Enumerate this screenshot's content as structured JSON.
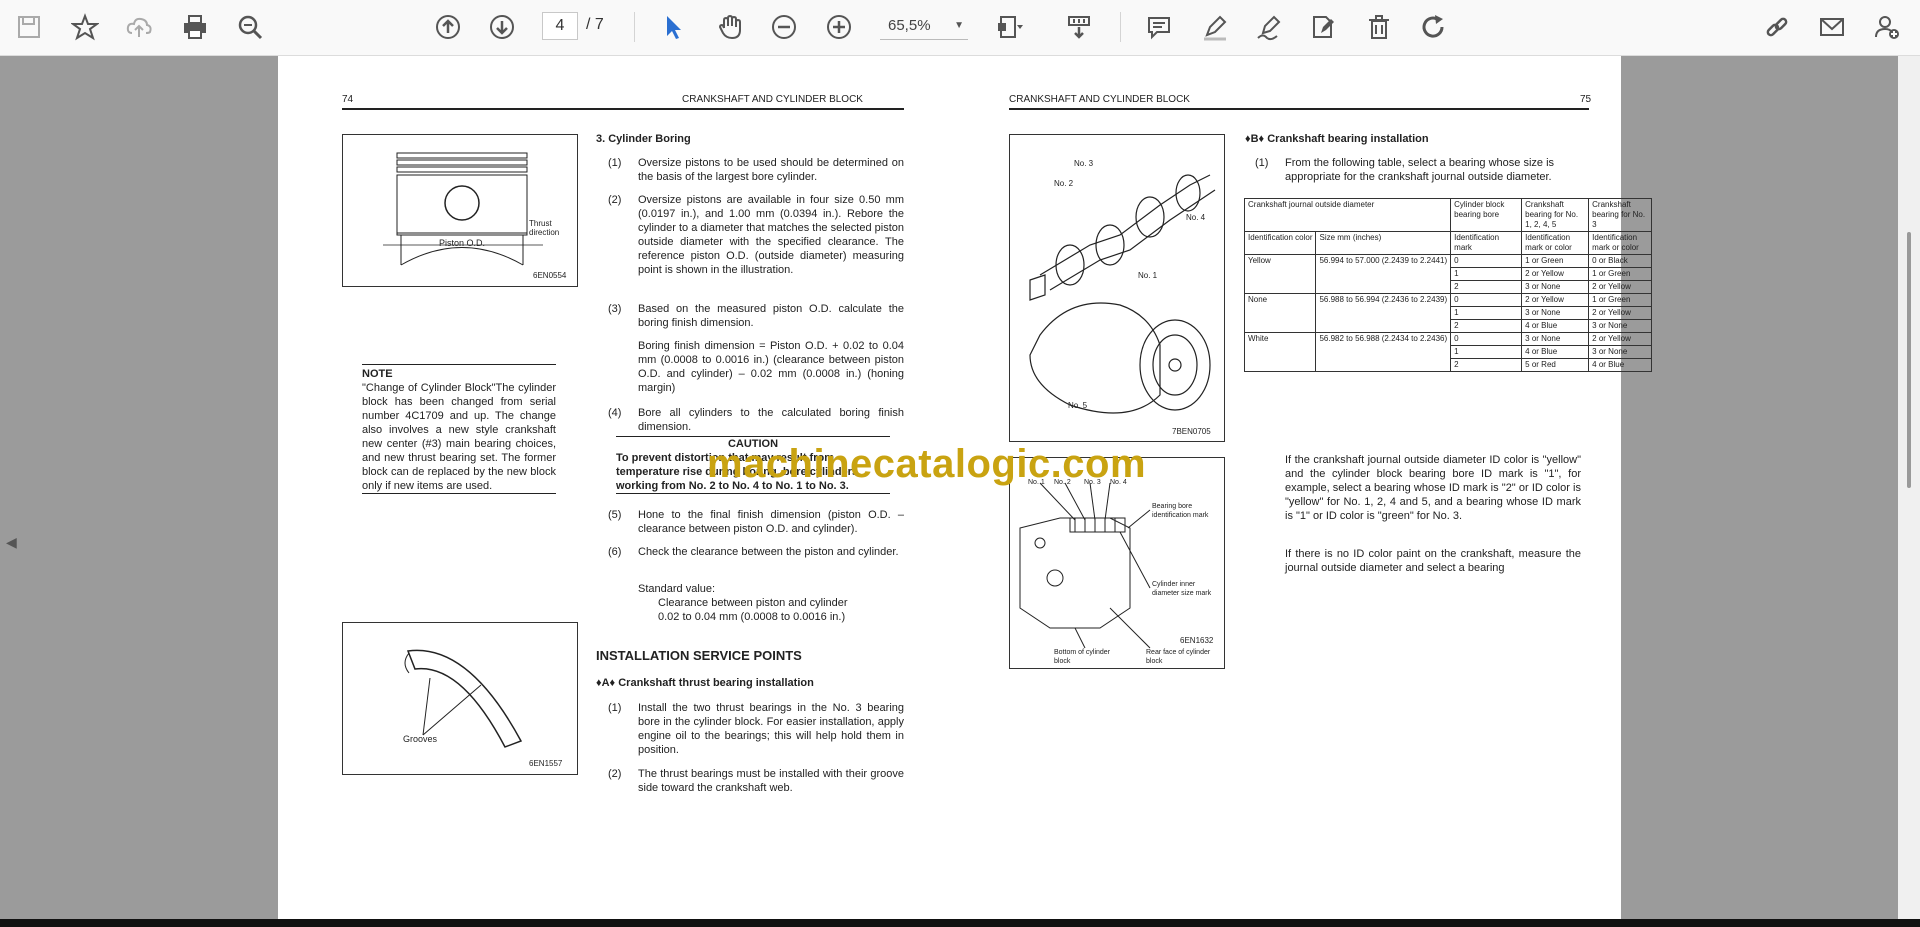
{
  "toolbar": {
    "page_current": "4",
    "page_total": "/ 7",
    "zoom": "65,5%"
  },
  "watermark": "machinecatalogic.com",
  "left_page": {
    "page_number": "74",
    "running_header": "CRANKSHAFT AND CYLINDER BLOCK",
    "fig1_caption": "6EN0554",
    "fig1_thrust": "Thrust direction",
    "fig1_piston": "Piston O.D.",
    "fig2_caption": "6EN1557",
    "fig2_label": "Grooves",
    "note_title": "NOTE",
    "note_body": "\"Change of Cylinder Block\"The cylinder block has been changed from serial number 4C1709 and up. The change also involves a new style crankshaft new center (#3) main bearing choices, and new thrust bearing set. The former block can de replaced by the new block only if new items are used.",
    "section3_title": "3.  Cylinder Boring",
    "step1": "Oversize pistons to be used should be determined on the basis of the largest bore cylinder.",
    "step2": "Oversize pistons are available in four size 0.50 mm (0.0197 in.), and 1.00 mm (0.0394 in.). Rebore the cylinder to a diameter that matches the selected piston outside diameter with the specified clearance. The reference piston O.D. (outside diameter) measuring point is shown in the illustration.",
    "step3": "Based on the measured piston O.D. calculate the boring finish dimension.",
    "boring_formula": "Boring finish dimension = Piston O.D. + 0.02 to 0.04 mm (0.0008 to 0.0016 in.) (clearance between piston O.D. and cylinder) – 0.02 mm (0.0008 in.) (honing margin)",
    "step4": "Bore all cylinders to the calculated boring finish dimension.",
    "caution_title": "CAUTION",
    "caution_body": "To prevent distortion that may result from temperature rise during boring, bore cylinders, working from No. 2 to No. 4 to No. 1 to No. 3.",
    "step5": "Hone to the final finish dimension (piston O.D. – clearance between piston O.D. and cylinder).",
    "step6": "Check the clearance between the piston and cylinder.",
    "standard_value": "Standard value:",
    "clearance_label": "Clearance between piston and cylinder",
    "clearance_value": "0.02 to 0.04 mm (0.0008 to 0.0016 in.)",
    "install_title": "INSTALLATION SERVICE POINTS",
    "subA_title": "♦A♦ Crankshaft thrust bearing installation",
    "a1": "Install the two thrust bearings in the No. 3 bearing bore in the cylinder block. For easier installation, apply engine oil to the bearings; this will help hold them in position.",
    "a2": "The thrust bearings must be installed with their groove side toward the crankshaft web."
  },
  "right_page": {
    "page_number": "75",
    "running_header": "CRANKSHAFT AND CYLINDER BLOCK",
    "fig3_caption": "7BEN0705",
    "fig3_labels": [
      "No. 3",
      "No. 2",
      "No. 4",
      "No. 1",
      "No. 5"
    ],
    "fig4_caption": "6EN1632",
    "fig4_labels": [
      "No. 1",
      "No. 2",
      "No. 3",
      "No. 4",
      "Bearing bore identification mark",
      "Cylinder inner diameter size mark",
      "Bottom of cylinder block",
      "Rear face of cylinder block"
    ],
    "subB_title": "♦B♦  Crankshaft bearing installation",
    "b1": "From the following table, select a bearing whose size is appropriate for the crankshaft journal outside diameter.",
    "table_headers": [
      "Crankshaft journal outside diameter",
      "Cylinder block bearing bore",
      "Crankshaft bearing for No. 1, 2, 4, 5",
      "Crankshaft bearing for No. 3"
    ],
    "table_subheaders": [
      "Identification color",
      "Size mm (inches)",
      "Identification mark",
      "Identification mark or color",
      "Identification mark or color"
    ],
    "table_rows": [
      [
        "Yellow",
        "56.994 to 57.000 (2.2439 to 2.2441)",
        "0",
        "1 or Green",
        "0 or Black"
      ],
      [
        "",
        "",
        "1",
        "2 or Yellow",
        "1 or Green"
      ],
      [
        "",
        "",
        "2",
        "3 or None",
        "2 or Yellow"
      ],
      [
        "None",
        "56.988 to 56.994 (2.2436 to 2.2439)",
        "0",
        "2 or Yellow",
        "1 or Green"
      ],
      [
        "",
        "",
        "1",
        "3 or None",
        "2 or Yellow"
      ],
      [
        "",
        "",
        "2",
        "4 or Blue",
        "3 or None"
      ],
      [
        "White",
        "56.982 to 56.988 (2.2434 to 2.2436)",
        "0",
        "3 or None",
        "2 or Yellow"
      ],
      [
        "",
        "",
        "1",
        "4 or Blue",
        "3 or None"
      ],
      [
        "",
        "",
        "2",
        "5 or Red",
        "4 or Blue"
      ]
    ],
    "para1": "If the crankshaft journal outside diameter ID color is \"yellow\" and the cylinder block bearing bore ID mark is \"1\", for example, select a bearing whose ID mark is \"2\" or ID color is \"yellow\" for No. 1, 2, 4 and 5, and a bearing whose ID mark is \"1\" or ID color is \"green\" for No. 3.",
    "para2": "If there is no ID color paint on the crankshaft, measure the journal outside diameter and select a bearing"
  }
}
